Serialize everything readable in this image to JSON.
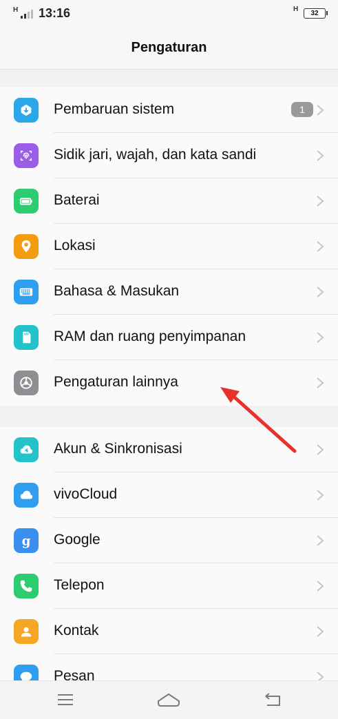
{
  "status_bar": {
    "network_left": "H",
    "time": "13:16",
    "network_right": "H",
    "battery": "32"
  },
  "header": {
    "title": "Pengaturan"
  },
  "group1": [
    {
      "label": "Pembaruan sistem",
      "icon": "system-update-icon",
      "color": "#29a7e8",
      "badge": "1"
    },
    {
      "label": "Sidik jari, wajah, dan kata sandi",
      "icon": "fingerprint-icon",
      "color": "#9b5de5"
    },
    {
      "label": "Baterai",
      "icon": "battery-icon",
      "color": "#2ecc71"
    },
    {
      "label": "Lokasi",
      "icon": "location-icon",
      "color": "#f39c12"
    },
    {
      "label": "Bahasa & Masukan",
      "icon": "keyboard-icon",
      "color": "#2f9df0"
    },
    {
      "label": "RAM dan ruang penyimpanan",
      "icon": "storage-icon",
      "color": "#22c3c9"
    },
    {
      "label": "Pengaturan lainnya",
      "icon": "more-settings-icon",
      "color": "#8e8e93"
    }
  ],
  "group2": [
    {
      "label": "Akun & Sinkronisasi",
      "icon": "account-sync-icon",
      "color": "#22c3c9"
    },
    {
      "label": "vivoCloud",
      "icon": "cloud-icon",
      "color": "#2f9df0"
    },
    {
      "label": "Google",
      "icon": "google-icon",
      "color": "#3b8ff0"
    },
    {
      "label": "Telepon",
      "icon": "phone-icon",
      "color": "#2ecc71"
    },
    {
      "label": "Kontak",
      "icon": "contacts-icon",
      "color": "#f5a623"
    },
    {
      "label": "Pesan",
      "icon": "messages-icon",
      "color": "#2f9df0"
    }
  ],
  "nav_bar": {
    "menu_icon": "menu-icon",
    "home_icon": "home-icon",
    "back_icon": "back-icon"
  },
  "annotation": {
    "arrow_color": "#e8312a"
  }
}
